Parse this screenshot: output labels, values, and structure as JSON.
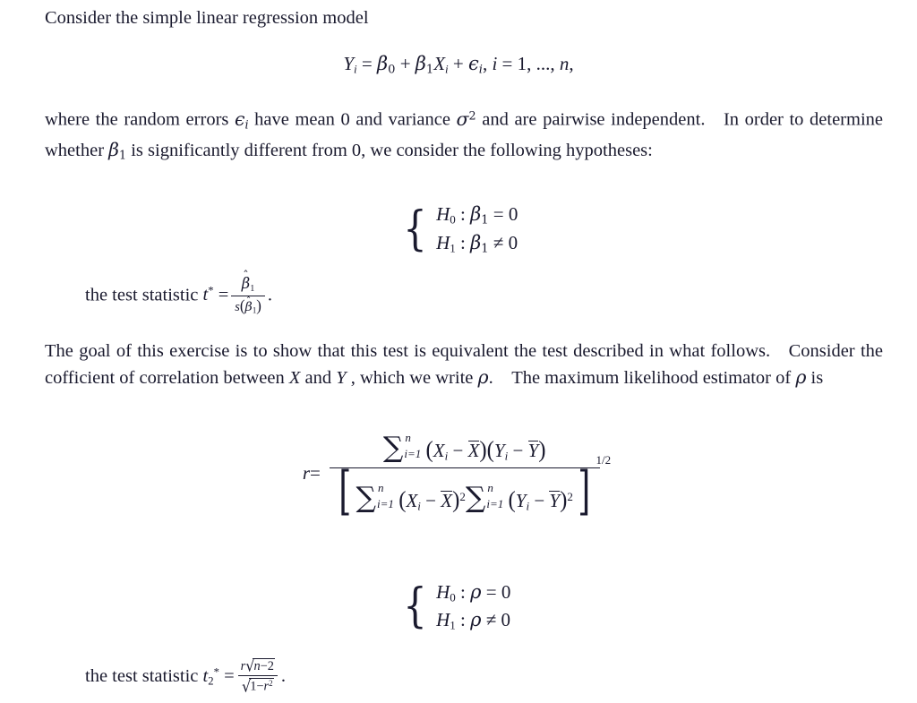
{
  "document": {
    "type": "mathematical-exercise",
    "paragraph1": "Consider the simple linear regression model",
    "equation_model": {
      "lhs": "Y",
      "lhs_sub": "i",
      "eq": "=",
      "beta0": "β",
      "beta0_sub": "0",
      "plus1": "+",
      "beta1": "β",
      "beta1_sub": "1",
      "X": "X",
      "X_sub": "i",
      "plus2": "+",
      "epsilon": "ϵ",
      "epsilon_sub": "i",
      "comma1": ",",
      "index": "i",
      "eq2": "=",
      "one": "1",
      "dots": ", ..., ",
      "n": "n",
      "comma2": ",",
      "plain": "Y_i = β0 + β1X_i + ϵ_i, i = 1, ..., n,"
    },
    "paragraph2_part1": "where the random errors ",
    "paragraph2_eps": "ϵ",
    "paragraph2_eps_sub": "i",
    "paragraph2_part2": " have mean 0 and variance ",
    "paragraph2_sigma": "σ",
    "paragraph2_sigma_sup": "2",
    "paragraph2_part3": " and are pairwise independent. In order to determine whether ",
    "paragraph2_beta": "β",
    "paragraph2_beta_sub": "1",
    "paragraph2_part4": " is significantly different from 0, we consider the following hypotheses:",
    "hypotheses_beta": {
      "brace": "{",
      "row1": {
        "H": "H",
        "H_sub": "0",
        "colon": ":",
        "param": "β",
        "param_sub": "1",
        "rel": "=",
        "value": "0",
        "plain": "H0 : β1 = 0"
      },
      "row2": {
        "H": "H",
        "H_sub": "1",
        "colon": ":",
        "param": "β",
        "param_sub": "1",
        "rel": "≠",
        "value": "0",
        "plain": "H1 : β1 ≠ 0"
      }
    },
    "test_statistic_1": {
      "lead": "the test statistic ",
      "symbol": "t",
      "symbol_sup": "*",
      "eq": "=",
      "numerator_base": "β",
      "numerator_hat": "ˆ",
      "numerator_sub": "1",
      "denominator_s": "s",
      "denominator_open": "(",
      "denominator_base": "β",
      "denominator_hat": "ˆ",
      "denominator_sub": "1",
      "denominator_close": ")",
      "period": ".",
      "plain": "the test statistic t* = β̂1 / s(β̂1)."
    },
    "paragraph3": "The goal of this exercise is to show that this test is equivalent the test described in what follows. Consider the cofficient of correlation between ",
    "paragraph3_X": "X",
    "paragraph3_mid": " and ",
    "paragraph3_Y": "Y",
    "paragraph3_part2": " , which we write ",
    "paragraph3_rho": "ρ",
    "paragraph3_part3": ". The maximum likelihood estimator of ",
    "paragraph3_rho2": "ρ",
    "paragraph3_part4": " is",
    "equation_r": {
      "lhs": "r",
      "eq": "=",
      "sum": "∑",
      "sum_lower": "i=1",
      "sum_upper": "n",
      "X": "X",
      "X_sub": "i",
      "minus": "−",
      "Xbar": "X",
      "Y": "Y",
      "Y_sub": "i",
      "Ybar": "Y",
      "open_paren": "(",
      "close_paren": ")",
      "square": "2",
      "open_bracket": "[",
      "close_bracket": "]",
      "exponent": "1/2",
      "plain_numerator": "∑(i=1..n) (X_i − X̄)(Y_i − Ȳ)",
      "plain_denominator": "[ ∑(i=1..n)(X_i − X̄)² ∑(i=1..n)(Y_i − Ȳ)² ]^(1/2)"
    },
    "hypotheses_rho": {
      "brace": "{",
      "row1": {
        "H": "H",
        "H_sub": "0",
        "colon": ":",
        "param": "ρ",
        "rel": "=",
        "value": "0",
        "plain": "H0 : ρ = 0"
      },
      "row2": {
        "H": "H",
        "H_sub": "1",
        "colon": ":",
        "param": "ρ",
        "rel": "≠",
        "value": "0",
        "plain": "H1 : ρ ≠ 0"
      }
    },
    "test_statistic_2": {
      "lead": "the test statistic ",
      "symbol": "t",
      "symbol_sub": "2",
      "symbol_sup": "*",
      "eq": "=",
      "num_r": "r",
      "radical": "√",
      "num_radicand_n": "n",
      "num_radicand_minus": "−",
      "num_radicand_2": "2",
      "den_radicand_1": "1",
      "den_radicand_minus": "−",
      "den_radicand_r": "r",
      "den_radicand_sup": "2",
      "period": ".",
      "plain": "the test statistic t₂* = r√(n−2) / √(1−r²)."
    },
    "colors": {
      "background": "#ffffff",
      "text": "#1a1a2e"
    }
  }
}
